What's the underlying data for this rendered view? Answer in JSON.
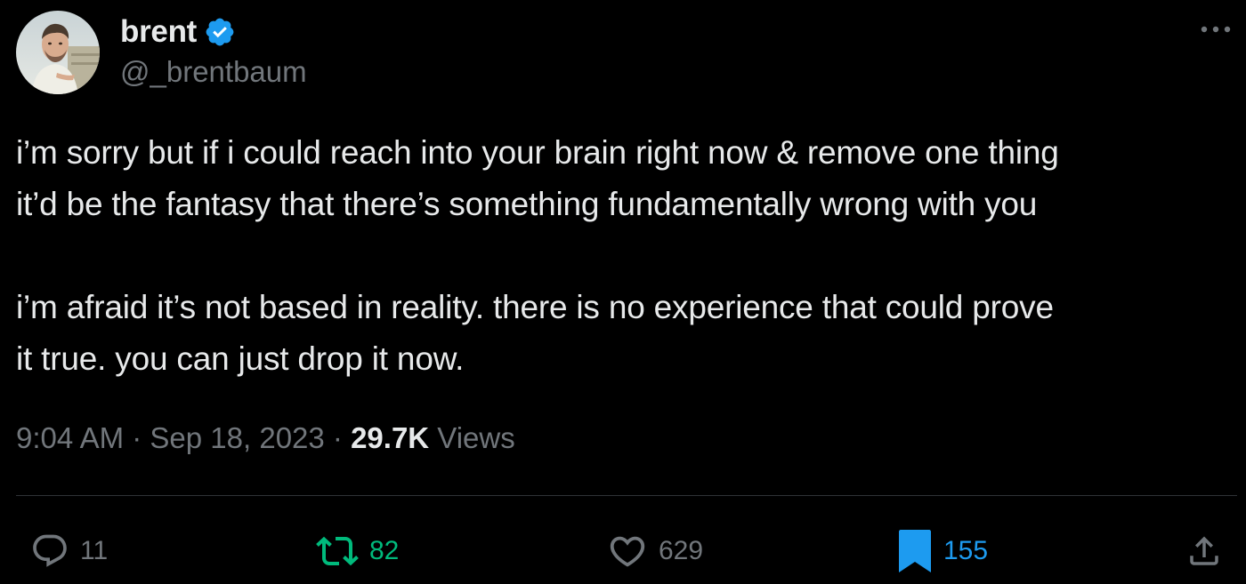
{
  "author": {
    "display_name": "brent",
    "handle": "@_brentbaum",
    "verified": true
  },
  "icons": {
    "verified": "verified-badge-icon",
    "more": "more-options-icon",
    "reply": "reply-icon",
    "retweet": "retweet-icon",
    "like": "heart-icon",
    "bookmark": "bookmark-filled-icon",
    "share": "share-icon"
  },
  "tweet": {
    "paragraph1_line1": "i’m sorry but if i could reach into your brain right now & remove one thing",
    "paragraph1_line2": "it’d be the fantasy that there’s something fundamentally wrong with you",
    "paragraph2_line1": "i’m afraid it’s not based in reality. there is no experience that could prove",
    "paragraph2_line2": "it true. you can just drop it now."
  },
  "meta": {
    "time": "9:04 AM",
    "separator": " · ",
    "date": "Sep 18, 2023",
    "views_count": "29.7K",
    "views_label": " Views"
  },
  "actions": {
    "replies": "11",
    "retweets": "82",
    "likes": "629",
    "bookmarks": "155"
  },
  "colors": {
    "background": "#000000",
    "text": "#e7e9ea",
    "secondary": "#71767b",
    "verified_blue": "#1d9bf0",
    "retweet_green": "#00ba7c",
    "bookmark_blue": "#1d9bf0",
    "divider": "#2f3336"
  }
}
